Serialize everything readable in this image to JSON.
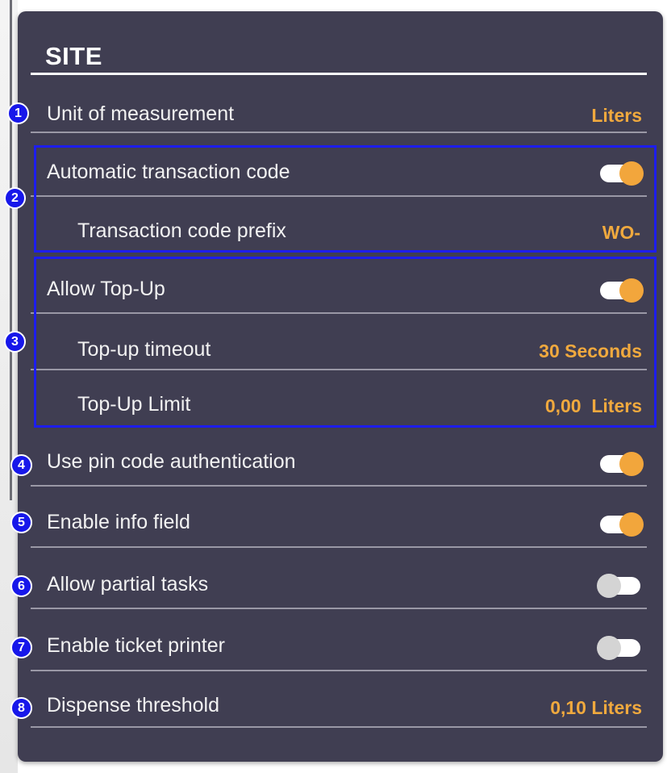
{
  "section": {
    "title": "SITE"
  },
  "settings": [
    {
      "id": "1",
      "label": "Unit of measurement",
      "value": "Liters"
    },
    {
      "id": "2a",
      "label": "Automatic transaction code",
      "toggle": true
    },
    {
      "id": "2b",
      "label": "Transaction code prefix",
      "value": "WO-"
    },
    {
      "id": "3a",
      "label": "Allow Top-Up",
      "toggle": true
    },
    {
      "id": "3b",
      "label": "Top-up timeout",
      "value": "30 Seconds"
    },
    {
      "id": "3c",
      "label": "Top-Up Limit",
      "value": "0,00  Liters"
    },
    {
      "id": "4",
      "label": "Use pin code authentication",
      "toggle": true
    },
    {
      "id": "5",
      "label": "Enable info field",
      "toggle": true
    },
    {
      "id": "6",
      "label": "Allow partial tasks",
      "toggle": false
    },
    {
      "id": "7",
      "label": "Enable ticket printer",
      "toggle": false
    },
    {
      "id": "8",
      "label": "Dispense threshold",
      "value": "0,10 Liters"
    }
  ],
  "badges": [
    "1",
    "2",
    "3",
    "4",
    "5",
    "6",
    "7",
    "8"
  ],
  "colors": {
    "panel": "#403e52",
    "accent": "#f2a63c",
    "toggle_off_knob": "#d4d4d4",
    "annotation": "#1717ea"
  }
}
